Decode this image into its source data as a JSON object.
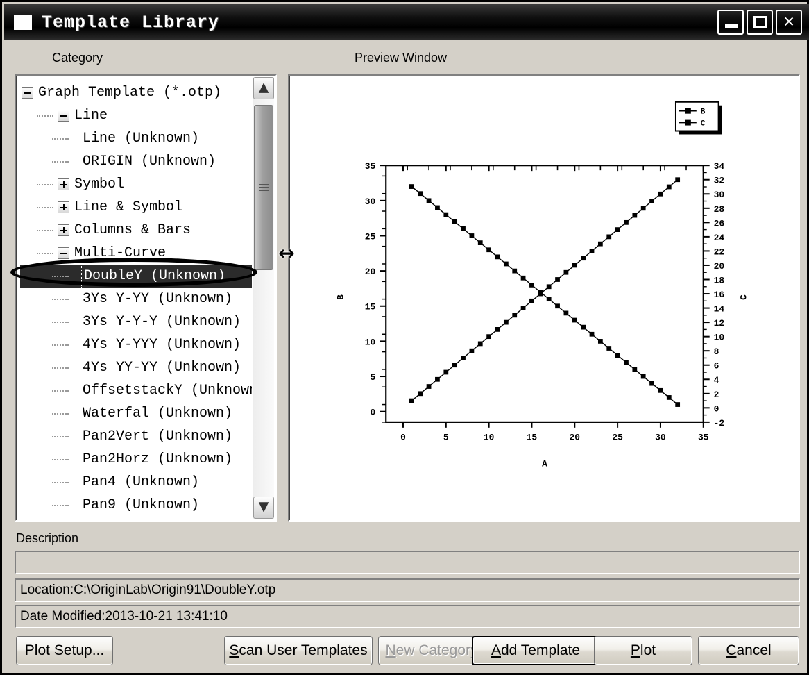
{
  "window": {
    "title": "Template Library",
    "icon": "window-icon",
    "controls": {
      "minimize": "minimize-icon",
      "maximize": "maximize-icon",
      "close": "close-icon"
    }
  },
  "panels": {
    "category_label": "Category",
    "preview_label": "Preview Window"
  },
  "tree": {
    "items": [
      {
        "label": "Graph Template (*.otp)",
        "depth": 0,
        "toggle": "minus",
        "selected": false
      },
      {
        "label": "Line",
        "depth": 1,
        "toggle": "minus",
        "selected": false
      },
      {
        "label": "Line (Unknown)",
        "depth": 2,
        "toggle": "leaf",
        "selected": false
      },
      {
        "label": "ORIGIN (Unknown)",
        "depth": 2,
        "toggle": "leaf",
        "selected": false
      },
      {
        "label": "Symbol",
        "depth": 1,
        "toggle": "plus",
        "selected": false
      },
      {
        "label": "Line & Symbol",
        "depth": 1,
        "toggle": "plus",
        "selected": false
      },
      {
        "label": "Columns & Bars",
        "depth": 1,
        "toggle": "plus",
        "selected": false
      },
      {
        "label": "Multi-Curve",
        "depth": 1,
        "toggle": "minus",
        "selected": false
      },
      {
        "label": "DoubleY (Unknown)",
        "depth": 2,
        "toggle": "leaf",
        "selected": true
      },
      {
        "label": "3Ys_Y-YY (Unknown)",
        "depth": 2,
        "toggle": "leaf",
        "selected": false
      },
      {
        "label": "3Ys_Y-Y-Y (Unknown)",
        "depth": 2,
        "toggle": "leaf",
        "selected": false
      },
      {
        "label": "4Ys_Y-YYY (Unknown)",
        "depth": 2,
        "toggle": "leaf",
        "selected": false
      },
      {
        "label": "4Ys_YY-YY (Unknown)",
        "depth": 2,
        "toggle": "leaf",
        "selected": false
      },
      {
        "label": "OffsetstackY (Unknown)",
        "depth": 2,
        "toggle": "leaf",
        "selected": false
      },
      {
        "label": "Waterfal (Unknown)",
        "depth": 2,
        "toggle": "leaf",
        "selected": false
      },
      {
        "label": "Pan2Vert (Unknown)",
        "depth": 2,
        "toggle": "leaf",
        "selected": false
      },
      {
        "label": "Pan2Horz (Unknown)",
        "depth": 2,
        "toggle": "leaf",
        "selected": false
      },
      {
        "label": "Pan4 (Unknown)",
        "depth": 2,
        "toggle": "leaf",
        "selected": false
      },
      {
        "label": "Pan9 (Unknown)",
        "depth": 2,
        "toggle": "leaf",
        "selected": false
      }
    ]
  },
  "info": {
    "description_label": "Description",
    "description_value": "",
    "location": "Location:C:\\OriginLab\\Origin91\\DoubleY.otp",
    "date_modified": "Date Modified:2013-10-21 13:41:10"
  },
  "buttons": {
    "plot_setup": "Plot Setup...",
    "scan_user_templates": "Scan User Templates",
    "new_category": "New Category",
    "add_template": "Add Template",
    "plot": "Plot",
    "cancel": "Cancel"
  },
  "chart_data": {
    "type": "scatter",
    "title": "",
    "xlabel": "A",
    "ylabel": "B",
    "y2label": "C",
    "xlim": [
      -2,
      35
    ],
    "ylim": [
      -1.5,
      35
    ],
    "y2lim": [
      -2,
      34
    ],
    "xticks": [
      0,
      5,
      10,
      15,
      20,
      25,
      30,
      35
    ],
    "yticks": [
      0,
      5,
      10,
      15,
      20,
      25,
      30,
      35
    ],
    "y2ticks": [
      -2,
      0,
      2,
      4,
      6,
      8,
      10,
      12,
      14,
      16,
      18,
      20,
      22,
      24,
      26,
      28,
      30,
      32,
      34
    ],
    "grid": false,
    "legend_position": "top-right",
    "x": [
      1,
      2,
      3,
      4,
      5,
      6,
      7,
      8,
      9,
      10,
      11,
      12,
      13,
      14,
      15,
      16,
      17,
      18,
      19,
      20,
      21,
      22,
      23,
      24,
      25,
      26,
      27,
      28,
      29,
      30,
      31,
      32
    ],
    "series": [
      {
        "name": "B",
        "axis": "left",
        "marker": "filled-square",
        "color": "#000000",
        "values": [
          32,
          31,
          30,
          29,
          28,
          27,
          26,
          25,
          24,
          23,
          22,
          21,
          20,
          19,
          18,
          17,
          16,
          15,
          14,
          13,
          12,
          11,
          10,
          9,
          8,
          7,
          6,
          5,
          4,
          3,
          2,
          1
        ]
      },
      {
        "name": "C",
        "axis": "right",
        "marker": "filled-square",
        "color": "#000000",
        "values": [
          1,
          2,
          3,
          4,
          5,
          6,
          7,
          8,
          9,
          10,
          11,
          12,
          13,
          14,
          15,
          16,
          17,
          18,
          19,
          20,
          21,
          22,
          23,
          24,
          25,
          26,
          27,
          28,
          29,
          30,
          31,
          32
        ]
      }
    ]
  }
}
